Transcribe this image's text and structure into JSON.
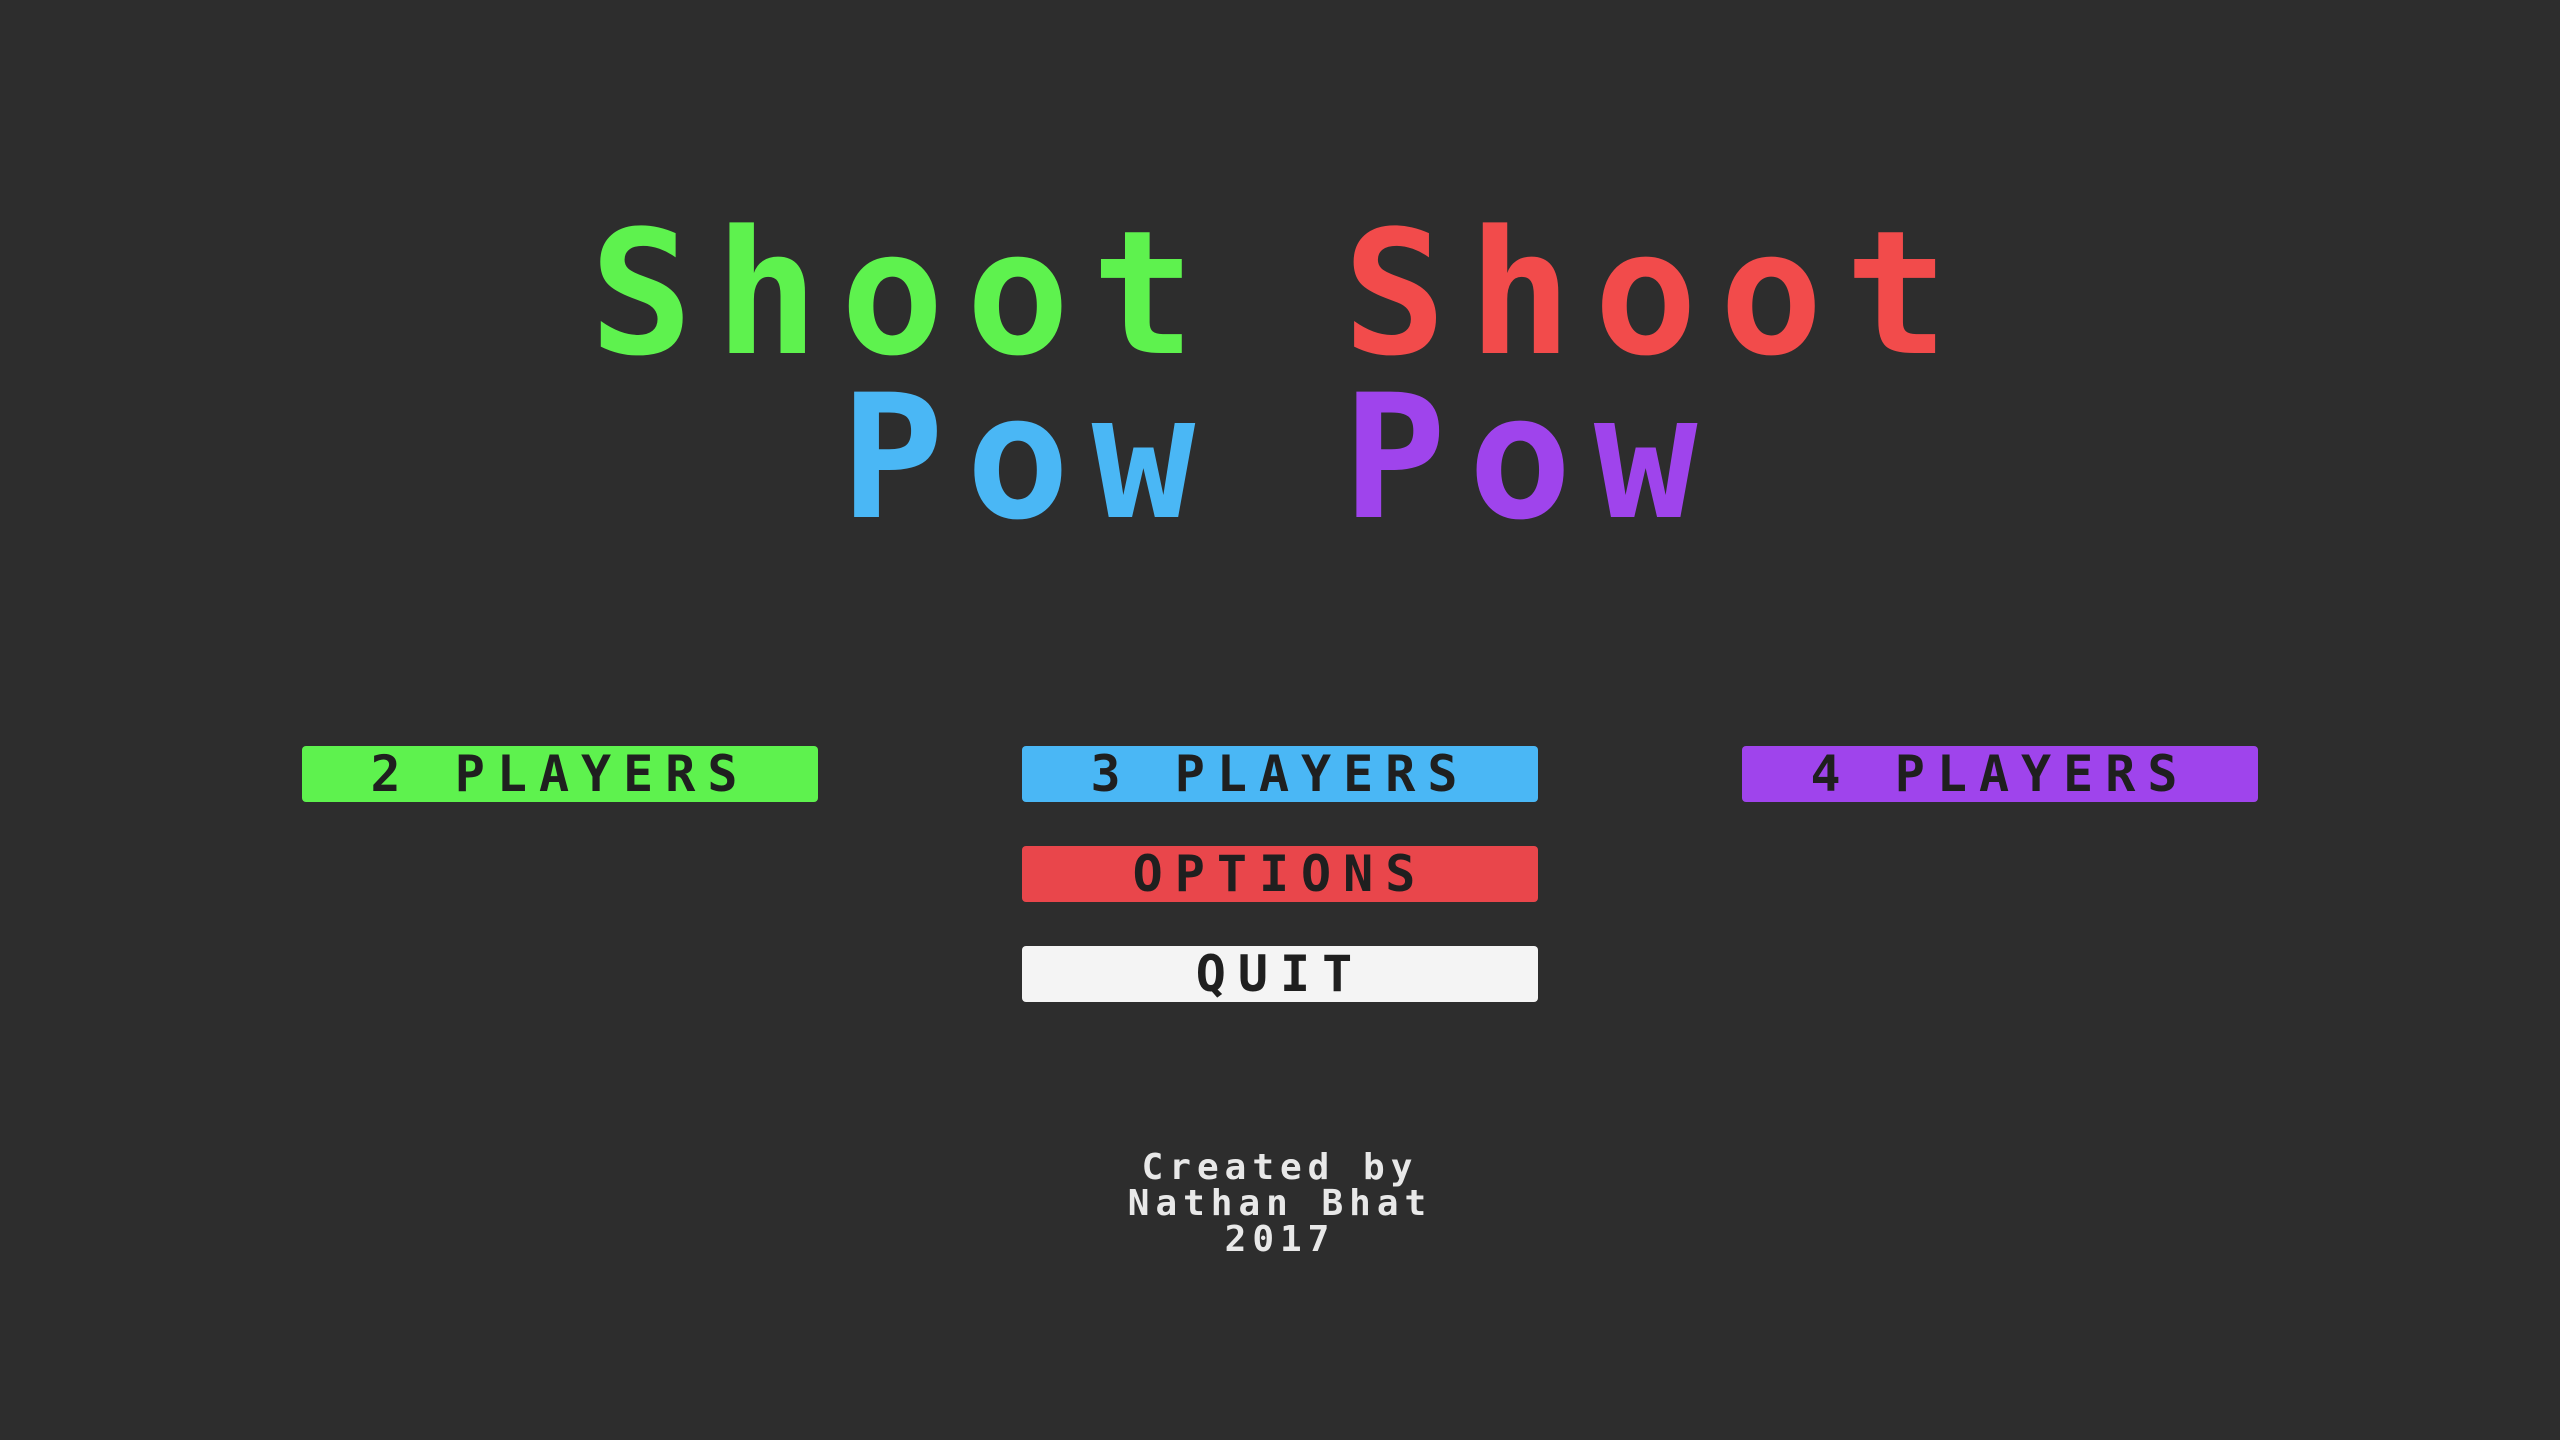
{
  "title": {
    "line1": {
      "word1": "Shoot",
      "word2": "Shoot"
    },
    "line2": {
      "word1": "Pow",
      "word2": "Pow"
    }
  },
  "menu": {
    "two_players": "2 PLAYERS",
    "three_players": "3 PLAYERS",
    "four_players": "4 PLAYERS",
    "options": "OPTIONS",
    "quit": "QUIT"
  },
  "credits": {
    "line1": "Created by",
    "line2": "Nathan Bhat",
    "line3": "2017"
  },
  "colors": {
    "background": "#2d2d2d",
    "green": "#5ef24e",
    "red": "#f24b4b",
    "blue": "#4ab7f5",
    "purple": "#9f44ec",
    "options_red": "#e9464b",
    "quit_white": "#f4f4f4",
    "button_text": "#1f1f1f",
    "credits_text": "#e8e8e8"
  }
}
